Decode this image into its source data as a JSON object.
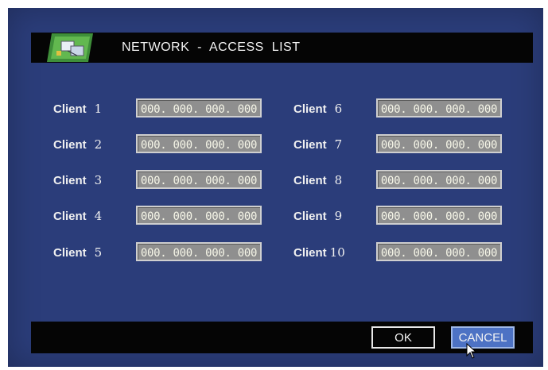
{
  "title": "NETWORK  -  ACCESS  LIST",
  "client_label": "Client",
  "clients": [
    {
      "number": "1",
      "ip": "000. 000. 000. 000"
    },
    {
      "number": "2",
      "ip": "000. 000. 000. 000"
    },
    {
      "number": "3",
      "ip": "000. 000. 000. 000"
    },
    {
      "number": "4",
      "ip": "000. 000. 000. 000"
    },
    {
      "number": "5",
      "ip": "000. 000. 000. 000"
    },
    {
      "number": "6",
      "ip": "000. 000. 000. 000"
    },
    {
      "number": "7",
      "ip": "000. 000. 000. 000"
    },
    {
      "number": "8",
      "ip": "000. 000. 000. 000"
    },
    {
      "number": "9",
      "ip": "000. 000. 000. 000"
    },
    {
      "number": "10",
      "ip": "000. 000. 000. 000"
    }
  ],
  "buttons": {
    "ok": "OK",
    "cancel": "CANCEL"
  },
  "icons": {
    "title": "network-icon",
    "pointer": "mouse-pointer-icon"
  },
  "colors": {
    "background": "#2b3d7a",
    "bar": "#050505",
    "field": "#8f8f8f",
    "cancel_active": "#4d72c4"
  }
}
